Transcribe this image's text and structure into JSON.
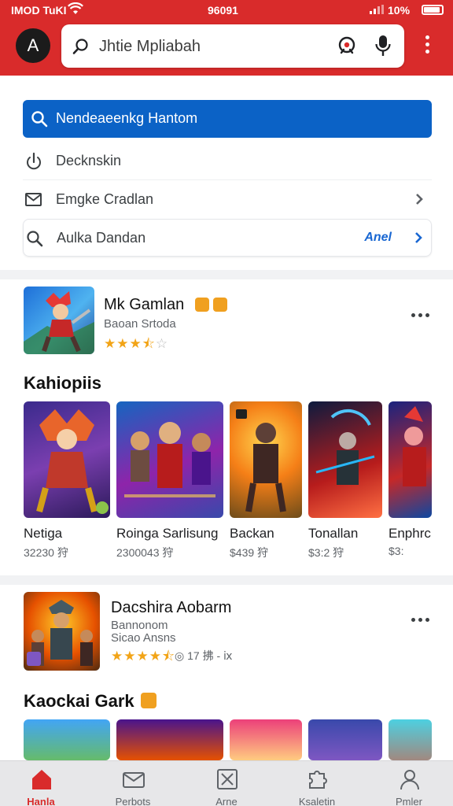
{
  "status_bar": {
    "carrier": "IMOD TuKI",
    "time": "96091",
    "battery_percent": "10%"
  },
  "header": {
    "avatar_letter": "A",
    "search_text": "Jhtie Mpliabah",
    "brand_color": "#d92b2b"
  },
  "suggestions": {
    "primary": "Nendeaeenkg Hantom",
    "items": [
      {
        "label": "Decknskin",
        "icon": "hand-icon"
      },
      {
        "label": "Emgke Cradlan",
        "icon": "mail-icon"
      },
      {
        "label": "Aulka Dandan",
        "icon": "search-icon",
        "action": "Anel"
      }
    ]
  },
  "card1": {
    "title": "Mk Gamlan",
    "subtitle": "Baoan Srtoda",
    "rating_stars": 3.5
  },
  "section1": {
    "title": "Kahiopiis",
    "tiles": [
      {
        "name": "Netiga",
        "price": "32230 狩"
      },
      {
        "name": "Roinga Sarlisung",
        "price": "2300043 狩"
      },
      {
        "name": "Backan",
        "price": "$439 狩"
      },
      {
        "name": "Tonallan",
        "price": "$3:2 狩"
      },
      {
        "name": "Enphrc",
        "price": "$3:"
      }
    ]
  },
  "card2": {
    "title": "Dacshira Aobarm",
    "subtitle_1": "Bannonom",
    "subtitle_2": "Sicao Ansns",
    "rating_stars": 4.5,
    "meta": "◎ 17 拂 - ⅸ"
  },
  "section2": {
    "title": "Kaockai Gark"
  },
  "bottom_nav": [
    {
      "label": "Hanla",
      "icon": "home-icon",
      "active": true
    },
    {
      "label": "Perbots",
      "icon": "envelope-icon",
      "active": false
    },
    {
      "label": "Arne",
      "icon": "apps-icon",
      "active": false
    },
    {
      "label": "Ksaletin",
      "icon": "puzzle-icon",
      "active": false
    },
    {
      "label": "Pmler",
      "icon": "person-icon",
      "active": false
    }
  ]
}
